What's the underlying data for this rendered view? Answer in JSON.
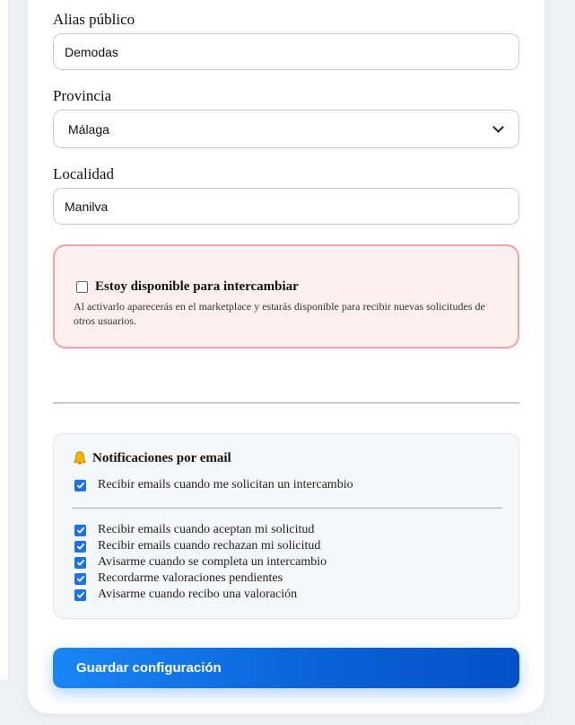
{
  "form": {
    "alias_label": "Alias público",
    "alias_value": "Demodas",
    "province_label": "Provincia",
    "province_value": "Málaga",
    "locality_label": "Localidad",
    "locality_value": "Manilva"
  },
  "availability": {
    "label": "Estoy disponible para intercambiar",
    "checked": false,
    "description": "Al activarlo aparecerás en el marketplace y estarás disponible para recibir nuevas solicitudes de otros usuarios."
  },
  "notifications": {
    "title": "Notificaciones por email",
    "icon": "bell-icon",
    "options": [
      {
        "label": "Recibir emails cuando me solicitan un intercambio",
        "checked": true
      },
      {
        "label": "Recibir emails cuando aceptan mi solicitud",
        "checked": true
      },
      {
        "label": "Recibir emails cuando rechazan mi solicitud",
        "checked": true
      },
      {
        "label": "Avisarme cuando se completa un intercambio",
        "checked": true
      },
      {
        "label": "Recordarme valoraciones pendientes",
        "checked": true
      },
      {
        "label": "Avisarme cuando recibo una valoración",
        "checked": true
      }
    ]
  },
  "actions": {
    "save_label": "Guardar configuración"
  },
  "colors": {
    "accent": "#1a73e8",
    "danger_border": "#f2a3a6",
    "danger_bg": "#fff0f0"
  }
}
